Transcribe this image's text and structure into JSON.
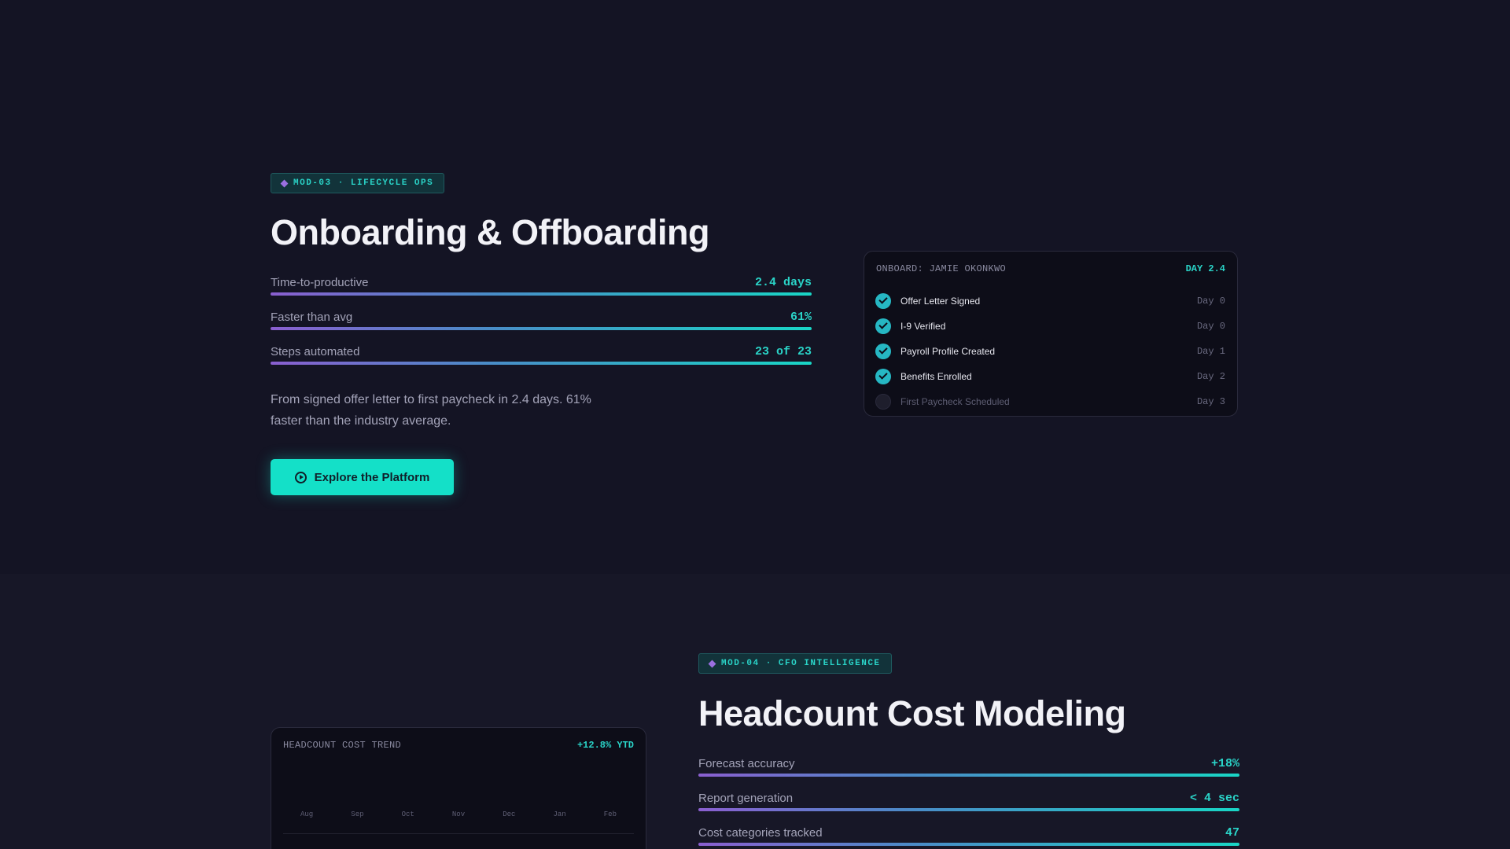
{
  "onboarding": {
    "badge": "MOD-03 · LIFECYCLE OPS",
    "title": "Onboarding & Offboarding",
    "metrics": [
      {
        "label": "Time-to-productive",
        "value": "2.4 days"
      },
      {
        "label": "Faster than avg",
        "value": "61%"
      },
      {
        "label": "Steps automated",
        "value": "23 of 23"
      }
    ],
    "description": "From signed offer letter to first paycheck in 2.4 days. 61% faster than the industry average.",
    "cta_label": "Explore the Platform",
    "card": {
      "title": "ONBOARD: JAMIE OKONKWO",
      "status": "DAY 2.4",
      "steps": [
        {
          "label": "Offer Letter Signed",
          "day": "Day 0",
          "done": true
        },
        {
          "label": "I-9 Verified",
          "day": "Day 0",
          "done": true
        },
        {
          "label": "Payroll Profile Created",
          "day": "Day 1",
          "done": true
        },
        {
          "label": "Benefits Enrolled",
          "day": "Day 2",
          "done": true
        },
        {
          "label": "First Paycheck Scheduled",
          "day": "Day 3",
          "done": false
        }
      ]
    }
  },
  "headcount": {
    "badge": "MOD-04 · CFO INTELLIGENCE",
    "title": "Headcount Cost Modeling",
    "metrics": [
      {
        "label": "Forecast accuracy",
        "value": "+18%"
      },
      {
        "label": "Report generation",
        "value": "< 4 sec"
      },
      {
        "label": "Cost categories tracked",
        "value": "47"
      }
    ],
    "card": {
      "title": "HEADCOUNT COST TREND",
      "status": "+12.8% YTD",
      "months": [
        "Aug",
        "Sep",
        "Oct",
        "Nov",
        "Dec",
        "Jan",
        "Feb"
      ]
    }
  },
  "colors": {
    "accent": "#14e0c8",
    "accent_text": "#2ad4c8",
    "purple": "#9a6fe0",
    "background": "#141424"
  },
  "icons": {
    "badge": "diamond-icon",
    "cta": "play-circle-icon",
    "step_done": "check-circle-icon"
  }
}
